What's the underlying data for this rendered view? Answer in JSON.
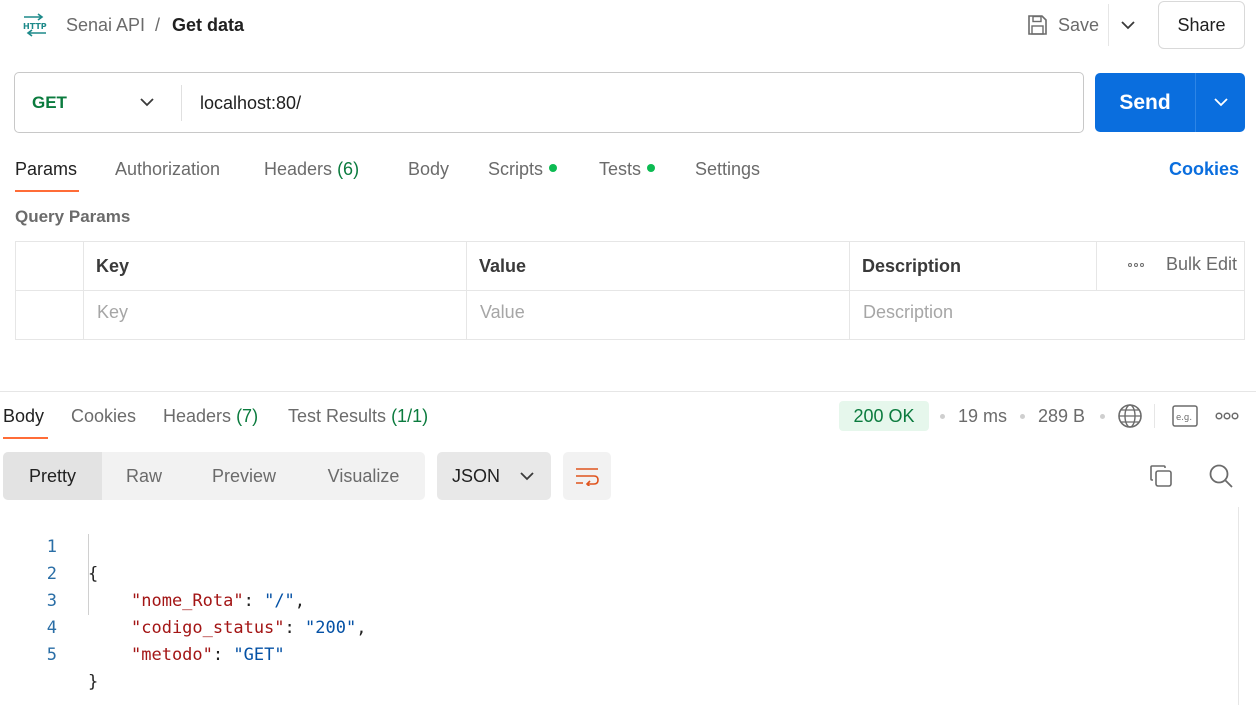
{
  "header": {
    "icon": "http-icon",
    "collection": "Senai API",
    "separator": "/",
    "request_name": "Get data",
    "save_label": "Save",
    "share_label": "Share"
  },
  "request": {
    "method": "GET",
    "url": "localhost:80/",
    "send_label": "Send"
  },
  "request_tabs": {
    "params": "Params",
    "authorization": "Authorization",
    "headers": "Headers",
    "headers_count": "(6)",
    "body": "Body",
    "scripts": "Scripts",
    "tests": "Tests",
    "settings": "Settings",
    "cookies": "Cookies",
    "active": "Params"
  },
  "query_params": {
    "title": "Query Params",
    "columns": [
      "Key",
      "Value",
      "Description"
    ],
    "bulk_edit": "Bulk Edit",
    "placeholders": {
      "key": "Key",
      "value": "Value",
      "description": "Description"
    }
  },
  "response_tabs": {
    "body": "Body",
    "cookies": "Cookies",
    "headers": "Headers",
    "headers_count": "(7)",
    "test_results": "Test Results",
    "test_results_count": "(1/1)",
    "active": "Body"
  },
  "response_meta": {
    "status": "200 OK",
    "time": "19 ms",
    "size": "289 B",
    "colors": {
      "status_bg": "#e6f7ec",
      "status_text": "#0b7b3e"
    }
  },
  "format_toolbar": {
    "modes": [
      "Pretty",
      "Raw",
      "Preview",
      "Visualize"
    ],
    "active_mode": "Pretty",
    "language": "JSON"
  },
  "response_body": {
    "line_numbers": [
      "1",
      "2",
      "3",
      "4",
      "5"
    ],
    "open_brace": "{",
    "close_brace": "}",
    "fields": [
      {
        "key": "\"nome_Rota\"",
        "value": "\"/\"",
        "trailing": ","
      },
      {
        "key": "\"codigo_status\"",
        "value": "\"200\"",
        "trailing": ","
      },
      {
        "key": "\"metodo\"",
        "value": "\"GET\"",
        "trailing": ""
      }
    ]
  },
  "colors": {
    "accent": "#0a6ede",
    "tab_underline": "#ff6c37",
    "method_get": "#0b7b3e",
    "dot_green": "#0cbb52"
  }
}
